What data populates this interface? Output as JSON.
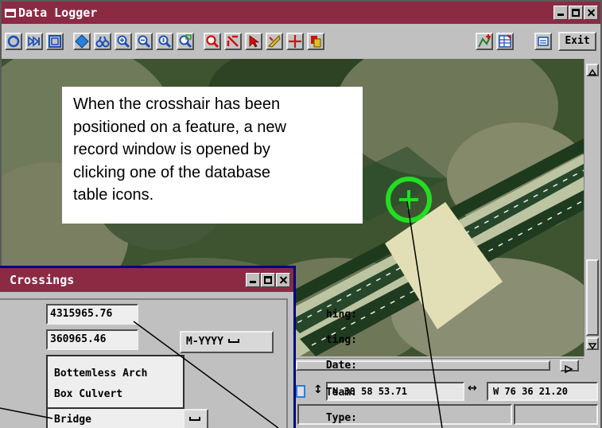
{
  "logger": {
    "title": "Data Logger",
    "exit_label": "Exit",
    "coords": {
      "latitude": "N 38 58 53.71",
      "longitude": "W 76 36 21.20"
    },
    "toolbar_icons": [
      "redraw-icon",
      "fast-forward-icon",
      "window-icon",
      "diamond-icon",
      "binoculars-icon",
      "zoom-in-icon",
      "zoom-out-icon",
      "zoom-full-icon",
      "zoom-box-icon",
      "red-magnifier-icon",
      "red-pointer-icon",
      "arrow-select-icon",
      "ruler-icon",
      "crosshair-icon",
      "layers-icon",
      "add-record-icon",
      "table-icon",
      "menu-icon"
    ]
  },
  "callout": {
    "lines": [
      "When the crosshair has been",
      "positioned on a feature, a new",
      "record window is opened by",
      "clicking one of the database",
      "table icons."
    ]
  },
  "crossings": {
    "title": "Crossings",
    "labels": {
      "northing": "hing:",
      "easting": "ting:",
      "date": "Date:",
      "team": "Team:",
      "type": "Type:"
    },
    "northing_value": "4315965.76",
    "easting_value": "360965.46",
    "date_format": "M-YYYY",
    "type_options": [
      "Bottemless Arch",
      "Box Culvert",
      "Bridge"
    ],
    "type_selected": "Bridge"
  },
  "colors": {
    "title_bar": "#8c2a44",
    "crosshair": "#22dd22",
    "window_frame": "#000080"
  }
}
